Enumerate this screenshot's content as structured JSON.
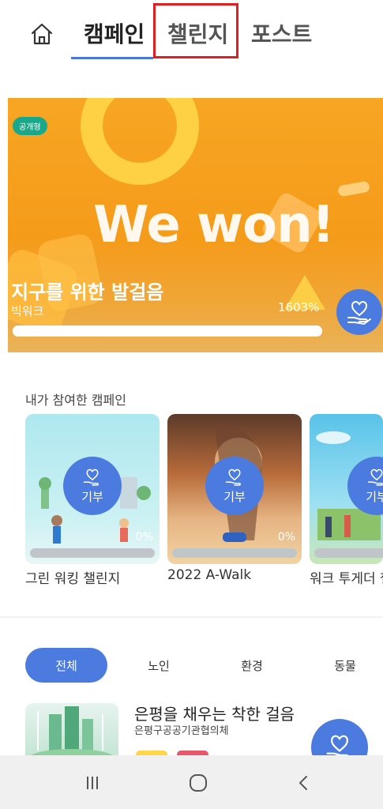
{
  "tabs": {
    "campaign": "캠페인",
    "challenge": "챌린지",
    "post": "포스트"
  },
  "hero": {
    "badge": "공개형",
    "headline": "We won!",
    "title": "지구를 위한 발걸음",
    "subtitle": "빅워크",
    "percent_text": "1603%",
    "progress": 1.0
  },
  "my_campaigns": {
    "label": "내가 참여한 캠페인",
    "cards": [
      {
        "button_label": "기부",
        "percent": "0%",
        "title": "그린 워킹 챌린지"
      },
      {
        "button_label": "기부",
        "percent": "0%",
        "title": "2022 A-Walk"
      },
      {
        "button_label": "기부",
        "percent": "",
        "title": "워크 투게더 챌"
      }
    ]
  },
  "categories": [
    "전체",
    "노인",
    "환경",
    "동물"
  ],
  "list_item": {
    "title": "은평을 채우는 착한 걸음",
    "subtitle": "은평구공공기관협의체"
  },
  "colors": {
    "accent": "#4c7be0",
    "hero_orange": "#f7a623",
    "badge_green": "#19a88a",
    "highlight_red": "#e02020"
  }
}
